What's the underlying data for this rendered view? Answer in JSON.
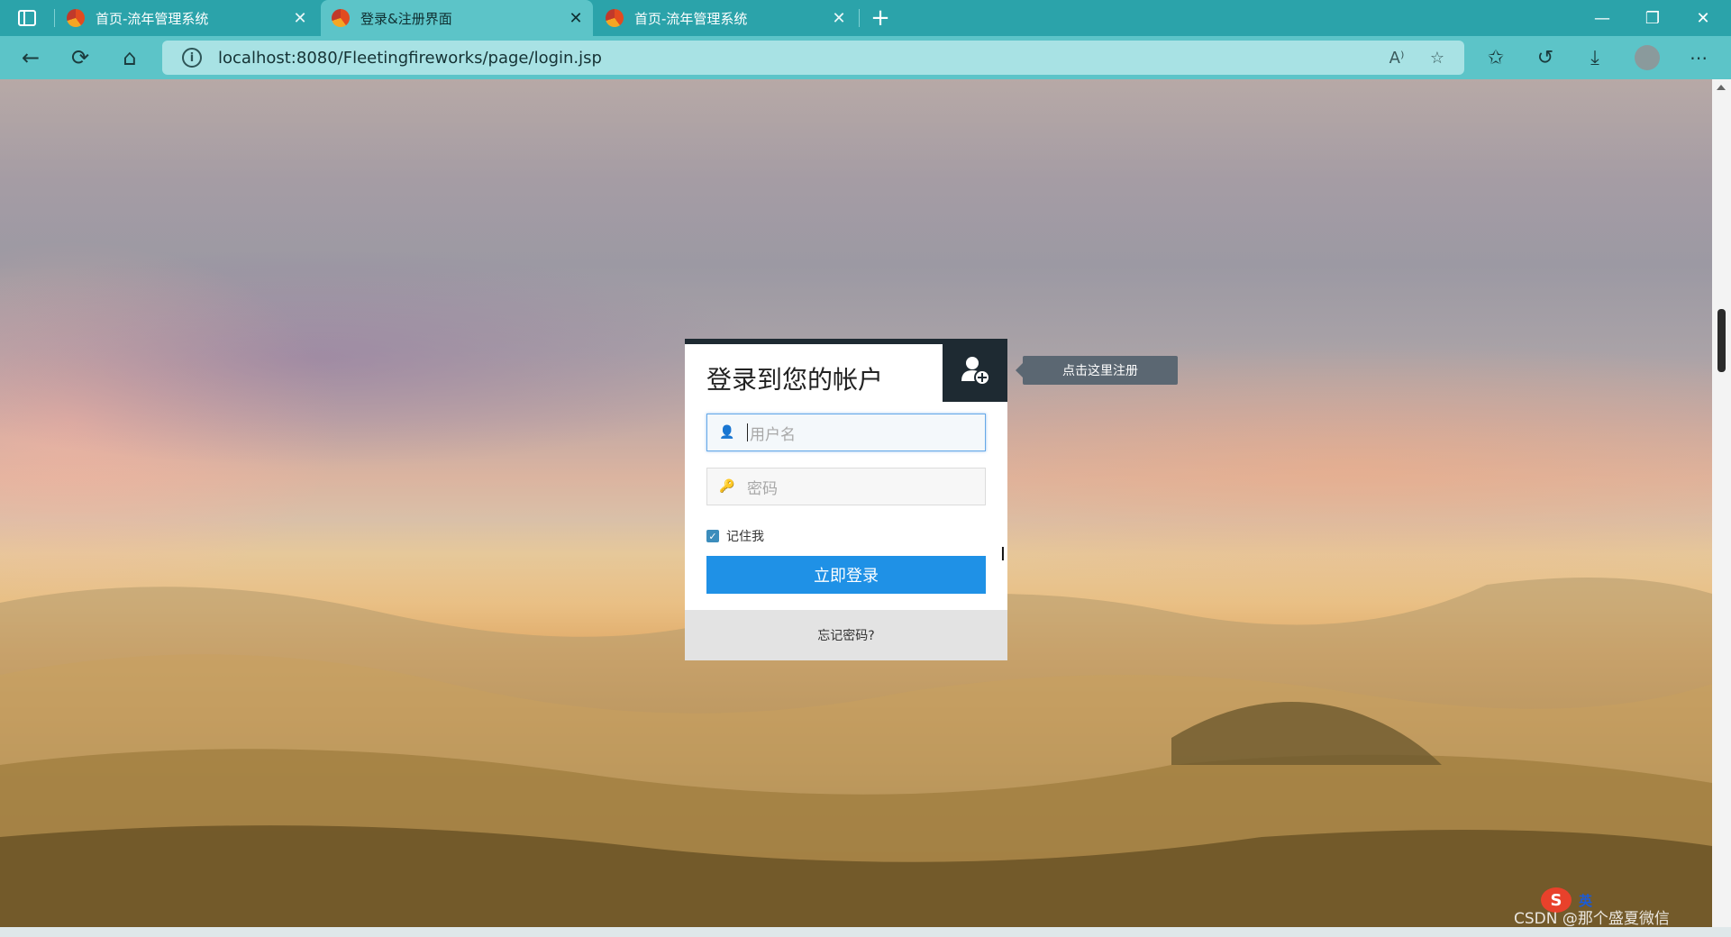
{
  "browser": {
    "tabs": [
      {
        "label": "首页-流年管理系统",
        "active": false
      },
      {
        "label": "登录&注册界面",
        "active": true
      },
      {
        "label": "首页-流年管理系统",
        "active": false
      }
    ],
    "new_tab_icon": "plus-icon",
    "address": "localhost:8080/Fleetingfireworks/page/login.jsp",
    "info_icon_glyph": "i",
    "read_aloud_glyph": "A⁾"
  },
  "login": {
    "title": "登录到您的帐户",
    "register_tooltip": "点击这里注册",
    "username_placeholder": "用户名",
    "password_placeholder": "密码",
    "remember_label": "记住我",
    "login_button": "立即登录",
    "forgot_link": "忘记密码?"
  },
  "overlay": {
    "watermark": "CSDN @那个盛夏微信",
    "ime_logo": "S",
    "ime_lang": "英"
  },
  "colors": {
    "tabbar": "#2ba3aa",
    "navbar": "#5cc4c8",
    "card_dark": "#1e2a32",
    "primary": "#1f91e6"
  }
}
